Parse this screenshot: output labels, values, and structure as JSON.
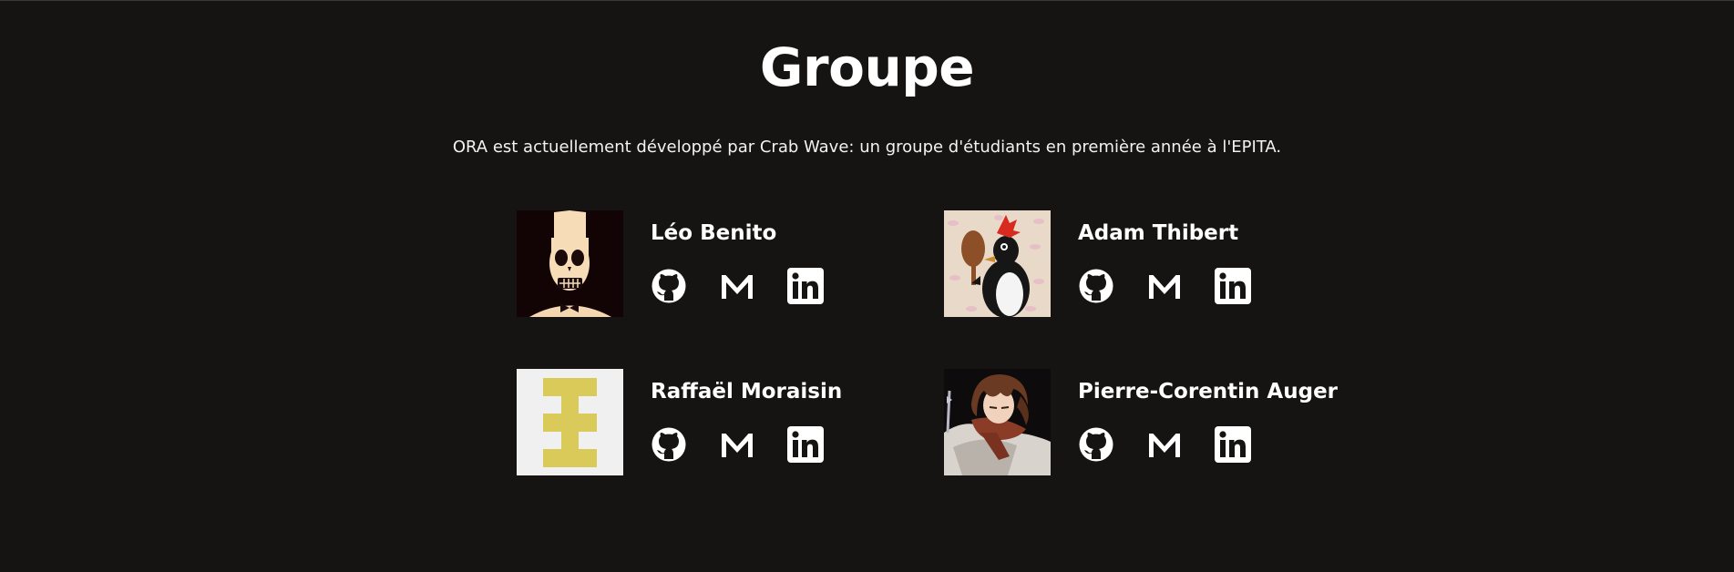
{
  "section": {
    "title": "Groupe",
    "description": "ORA est actuellement développé par Crab Wave: un groupe d'étudiants en première année à l'EPITA."
  },
  "members": [
    {
      "name": "Léo Benito",
      "avatar": "skeleton-character-avatar",
      "links": [
        "github-icon",
        "mail-icon",
        "linkedin-icon"
      ]
    },
    {
      "name": "Adam Thibert",
      "avatar": "penguin-figure-avatar",
      "links": [
        "github-icon",
        "mail-icon",
        "linkedin-icon"
      ]
    },
    {
      "name": "Raffaël Moraisin",
      "avatar": "yellow-pixel-logo-avatar",
      "links": [
        "github-icon",
        "mail-icon",
        "linkedin-icon"
      ]
    },
    {
      "name": "Pierre-Corentin Auger",
      "avatar": "anime-character-avatar",
      "links": [
        "github-icon",
        "mail-icon",
        "linkedin-icon"
      ]
    }
  ],
  "colors": {
    "background": "#151413",
    "text": "#ffffff",
    "avatar_yellow": "#d9ca5a"
  }
}
